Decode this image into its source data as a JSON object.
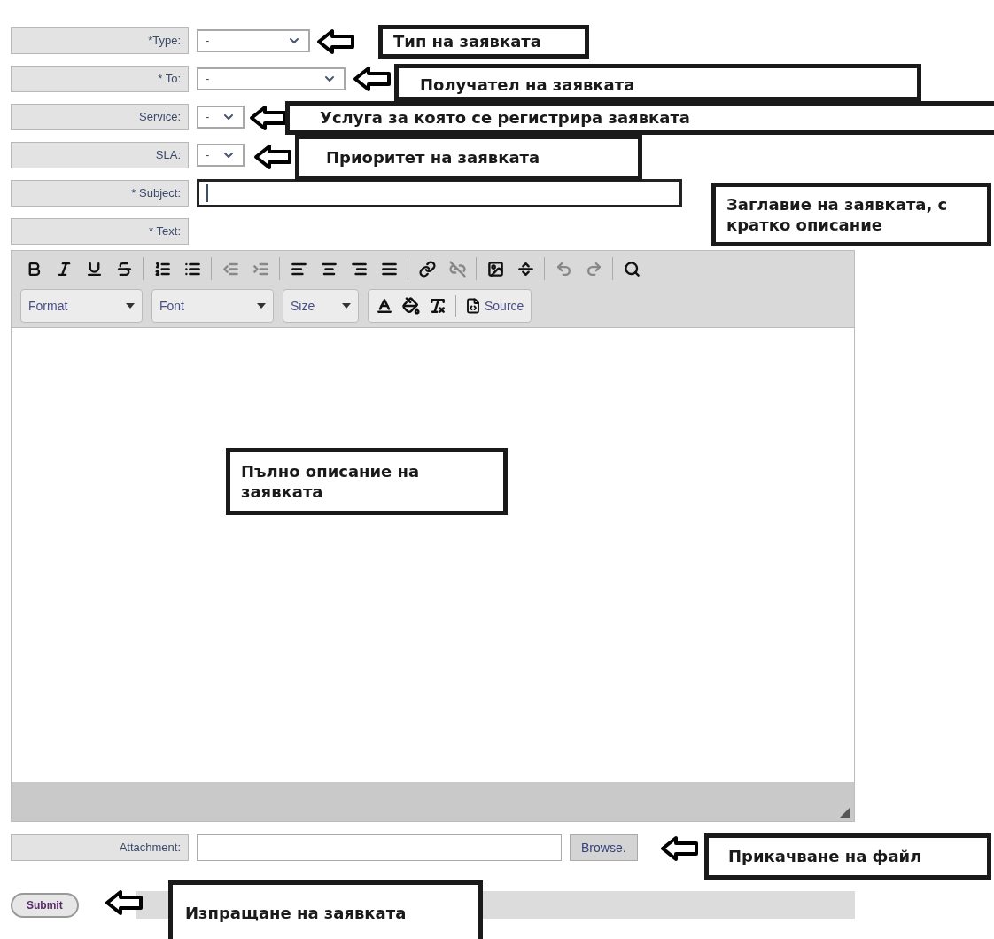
{
  "form": {
    "fields": [
      {
        "kind": "select",
        "label": "*Type:",
        "value": "-"
      },
      {
        "kind": "select",
        "label": "* To:",
        "value": "-"
      },
      {
        "kind": "select",
        "label": "Service:",
        "value": "-"
      },
      {
        "kind": "select",
        "label": "SLA:",
        "value": "-"
      },
      {
        "kind": "text",
        "label": "* Subject:",
        "focused": true
      },
      {
        "kind": "label",
        "label": "* Text:"
      }
    ]
  },
  "editor": {
    "toolbar": [
      {
        "disabled": false
      },
      {
        "disabled": false
      },
      {
        "disabled": false
      },
      {
        "disabled": false
      },
      {
        "disabled": false
      },
      {
        "disabled": false
      },
      {
        "disabled": true
      },
      {
        "disabled": true
      },
      {
        "disabled": false
      },
      {
        "disabled": false
      },
      {
        "disabled": false
      },
      {
        "disabled": false
      },
      {
        "disabled": false
      },
      {
        "disabled": true
      },
      {
        "disabled": false
      },
      {
        "disabled": false
      },
      {
        "disabled": true
      },
      {
        "disabled": true
      },
      {
        "disabled": false
      }
    ],
    "combos": [
      {
        "label": "Format"
      },
      {
        "label": "Font"
      },
      {
        "label": "Size"
      }
    ],
    "source_button": "Source"
  },
  "attachment": {
    "label": "Attachment:",
    "browse_button": "Browse."
  },
  "submit_button": "Submit",
  "annotations": [
    {
      "text": "Тип на заявката",
      "arrow": true
    },
    {
      "text": "Получател на заявката",
      "arrow": true
    },
    {
      "text": "Услуга за която се регистрира заявката",
      "arrow": true
    },
    {
      "text": "Приоритет на заявката",
      "arrow": true
    },
    {
      "text": "Заглавие на заявката, с кратко описание",
      "arrow": false
    },
    {
      "text": "Пълно описание на заявката",
      "arrow": false
    },
    {
      "text": "Прикачване на файл",
      "arrow": true
    },
    {
      "text": "Изпращане на заявката",
      "arrow": true
    }
  ]
}
